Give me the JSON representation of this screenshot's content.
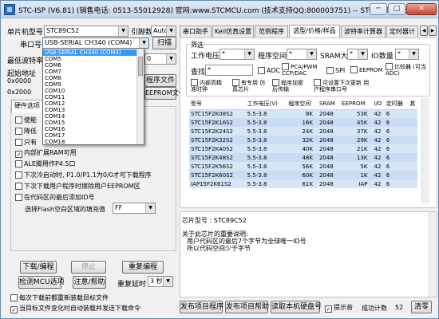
{
  "window": {
    "title": "STC-ISP (V6.81) (销售电话: 0513-55012928) 官网:www.STCMCU.com (技术支持QQ:800003751) -- STC: 全球最大的80...",
    "min_label": "─",
    "max_label": "□",
    "close_label": "✕"
  },
  "left": {
    "mcu_label": "单片机型号",
    "mcu_value": "STC89C52",
    "pin_label": "引脚数",
    "pin_value": "Auto",
    "port_label": "串口号",
    "port_value": "USB-SERIAL CH340 (COM4)",
    "scan_button": "扫描",
    "baud_label": "最低波特率",
    "baud_value": "0",
    "start_label": "起始地址",
    "addr1": "0x0000",
    "addr2": "0x2000",
    "open_file_button": "程序文件",
    "open_eeprom_button": "EEPROM文件",
    "hw_tab": "硬件选项",
    "options": [
      {
        "label": "使能",
        "checked": false
      },
      {
        "label": "降低",
        "checked": false
      },
      {
        "label": "只有",
        "checked": false
      },
      {
        "label": "内部扩展RAM可用",
        "checked": true
      },
      {
        "label": "ALE脚用作P4.5口",
        "checked": false
      },
      {
        "label": "下次冷启动时, P1.0/P1.1为0/0才可下载程序",
        "checked": false
      },
      {
        "label": "下次下载用户程序时擦除用户EEPROM区",
        "checked": false
      },
      {
        "label": "在代码区的最后添加ID号",
        "checked": false
      }
    ],
    "fill_label": "选择Flash空白区域的填充值",
    "fill_value": "FF",
    "download_button": "下载/编程",
    "stop_button": "停止",
    "reprogram_button": "重复编程",
    "detect_button": "检测MCU选项",
    "help_button": "注意/帮助",
    "delay_label": "重复延时",
    "delay_value": "3 秒",
    "reload_label": "每次下载前都重新装载目标文件",
    "autoload_label": "当目标文件变化时自动装载并发送下载命令"
  },
  "dropdown": {
    "items": [
      "USB-SERIAL CH340 (COM4)",
      "COM5",
      "COM6",
      "COM7",
      "COM8",
      "COM9",
      "COM10",
      "COM11",
      "COM12",
      "COM13",
      "COM14",
      "COM15",
      "COM16",
      "COM17",
      "COM18"
    ]
  },
  "tabs": [
    "串口助手",
    "Keil仿真设置",
    "范例程序",
    "选型/价格/样品",
    "波特率计算器",
    "定时器计"
  ],
  "right": {
    "filter_title": "筛选",
    "voltage_label": "工作电压",
    "flash_label": "程序空间",
    "sram_label": "SRAM大小",
    "io_label": "IO数量",
    "find_label": "查找",
    "find_value": "*",
    "adc_label": "ADC",
    "pca_label": "PCA/PWM CCP/DAC",
    "spi_label": "SPI",
    "eeprom_label": "EEPROM",
    "compare_label": "比较器 (可当ADC)",
    "internal_osc_label": "内部高精 准时钟",
    "emu_label": "有专用 仿真芯片",
    "encrypt_label": "程序加密 后传输",
    "userset_label": "可设置下次更新 用户程序串口号",
    "combo_star": "*",
    "columns": [
      "型号",
      "工作电压(V)",
      "程序空间",
      "SRAM",
      "EEPROM",
      "I/O",
      "定时器",
      "其"
    ],
    "rows": [
      [
        "STC15F2K08S2",
        "5.5-3.8",
        "8K",
        "2048",
        "53K",
        "42",
        "6"
      ],
      [
        "STC15F2K16S2",
        "5.5-3.8",
        "16K",
        "2048",
        "45K",
        "42",
        "6"
      ],
      [
        "STC15F2K24S2",
        "5.5-3.8",
        "24K",
        "2048",
        "37K",
        "42",
        "6"
      ],
      [
        "STC15F2K32S2",
        "5.5-3.8",
        "32K",
        "2048",
        "29K",
        "42",
        "6"
      ],
      [
        "STC15F2K40S2",
        "5.5-3.8",
        "40K",
        "2048",
        "21K",
        "42",
        "6"
      ],
      [
        "STC15F2K48S2",
        "5.5-3.8",
        "48K",
        "2048",
        "13K",
        "42",
        "6"
      ],
      [
        "STC15F2K56S2",
        "5.5-3.8",
        "56K",
        "2048",
        "5K",
        "42",
        "6"
      ],
      [
        "STC15F2K60S2",
        "5.5-3.8",
        "60K",
        "2048",
        "1K",
        "42",
        "6"
      ],
      [
        "IAP15F2K61S2",
        "5.5-3.8",
        "61K",
        "2048",
        "IAP",
        "42",
        "6"
      ]
    ],
    "info_chip_label": "芯片型号 : STC89C52",
    "info_line1": "关于此芯片的重要说明:",
    "info_line2": "用户代码区的最后7个字节为全球唯一ID号",
    "info_line3": "所以代码空间少于字节",
    "publish_prog_button": "发布项目程序",
    "publish_help_button": "发布项目帮助",
    "read_serial_button": "读取本机硬盘号",
    "beep_label": "提示音",
    "count_label": "成功计数",
    "count_value": "52",
    "clear_button": "清零"
  }
}
